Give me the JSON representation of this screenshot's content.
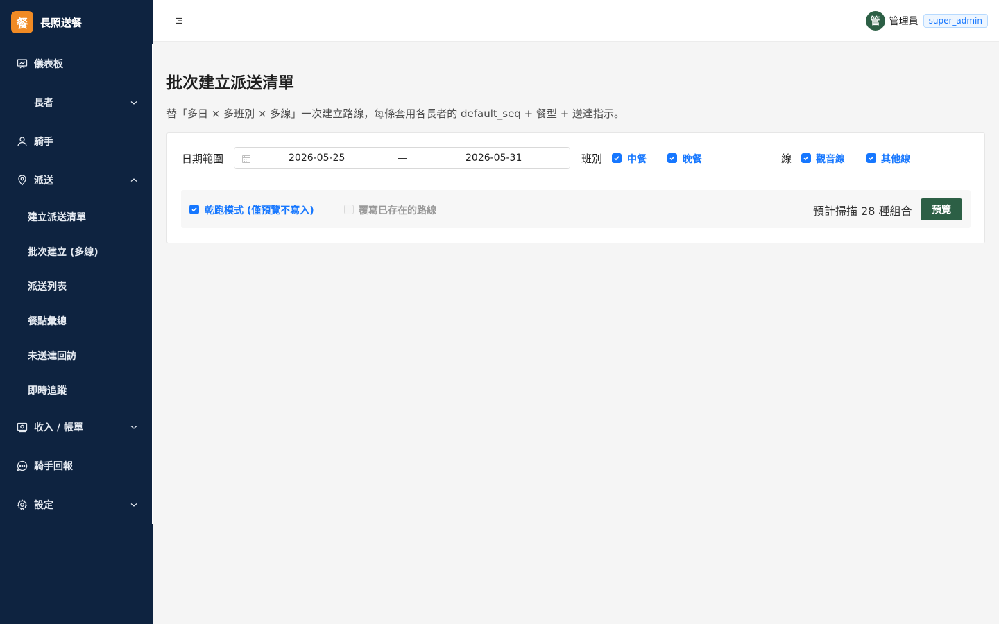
{
  "app": {
    "logo_char": "餐",
    "name": "長照送餐"
  },
  "sidebar": {
    "dashboard": "儀表板",
    "elders": "長者",
    "riders": "騎手",
    "dispatch": "派送",
    "dispatch_children": [
      "建立派送清單",
      "批次建立 (多線)",
      "派送列表",
      "餐點彙總",
      "未送達回訪",
      "即時追蹤"
    ],
    "billing": "收入 / 帳單",
    "rider_reports": "騎手回報",
    "settings": "設定"
  },
  "header": {
    "avatar_char": "管",
    "user_name": "管理員",
    "role": "super_admin"
  },
  "page": {
    "title": "批次建立派送清單",
    "description": "替「多日 × 多班別 × 多線」一次建立路線，每條套用各長者的 default_seq + 餐型 + 送達指示。"
  },
  "form": {
    "date_range_label": "日期範圍",
    "date_start": "2026-05-25",
    "date_end": "2026-05-31",
    "shift_label": "班別",
    "shifts": [
      {
        "label": "中餐",
        "checked": true
      },
      {
        "label": "晚餐",
        "checked": true
      }
    ],
    "line_label": "線",
    "lines": [
      {
        "label": "觀音線",
        "checked": true
      },
      {
        "label": "其他線",
        "checked": true
      }
    ],
    "dry_run": {
      "label": "乾跑模式 (僅預覽不寫入)",
      "checked": true
    },
    "overwrite": {
      "label": "覆寫已存在的路線",
      "checked": false,
      "disabled": true
    },
    "estimate": "預計掃描 28 種組合",
    "preview_button": "預覽"
  },
  "colors": {
    "sidebar_bg": "#0e2340",
    "brand_accent": "#f08a24",
    "primary_green": "#2c5f45",
    "checkbox_blue": "#1677ff"
  }
}
